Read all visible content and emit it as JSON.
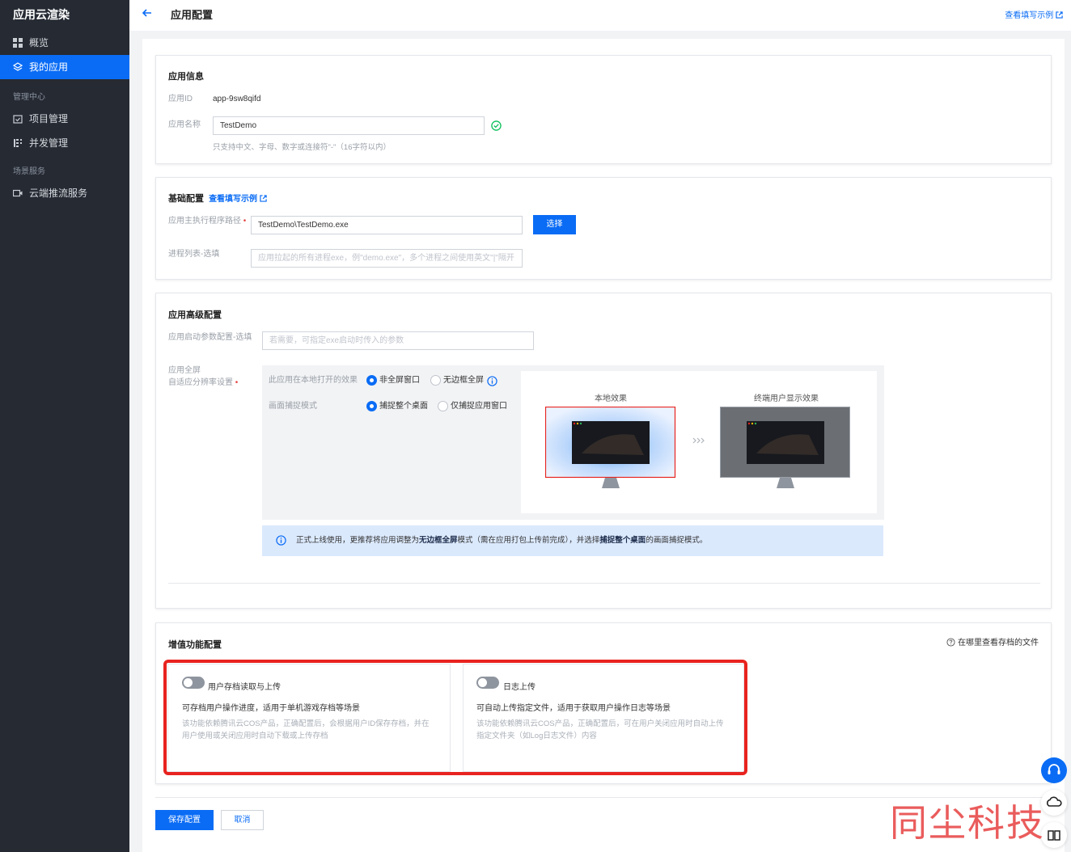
{
  "sidebar": {
    "brand": "应用云渲染",
    "items": [
      {
        "label": "概览"
      },
      {
        "label": "我的应用"
      }
    ],
    "section_mgmt": "管理中心",
    "mgmt_items": [
      {
        "label": "项目管理"
      },
      {
        "label": "并发管理"
      }
    ],
    "section_scene": "场景服务",
    "scene_items": [
      {
        "label": "云端推流服务"
      }
    ]
  },
  "header": {
    "title": "应用配置",
    "example_link": "查看填写示例"
  },
  "app_info": {
    "title": "应用信息",
    "id_label": "应用ID",
    "id_value": "app-9sw8qifd",
    "name_label": "应用名称",
    "name_value": "TestDemo",
    "name_hint": "只支持中文、字母、数字或连接符\"-\"（16字符以内）"
  },
  "basic": {
    "title": "基础配置",
    "example_link": "查看填写示例",
    "exe_label": "应用主执行程序路径",
    "exe_value": "TestDemo\\TestDemo.exe",
    "select_button": "选择",
    "process_label": "进程列表-选填",
    "process_placeholder": "应用拉起的所有进程exe，例\"demo.exe\"，多个进程之间使用英文\"|\"隔开"
  },
  "advanced": {
    "title": "应用高级配置",
    "params_label": "应用启动参数配置-选填",
    "params_placeholder": "若需要，可指定exe启动时传入的参数",
    "fullscreen_label_1": "应用全屏",
    "fullscreen_label_2": "自适应分辨率设置",
    "open_effect_label": "此应用在本地打开的效果",
    "open_opt_1": "非全屏窗口",
    "open_opt_2": "无边框全屏",
    "capture_label": "画面捕捉模式",
    "capture_opt_1": "捕捉整个桌面",
    "capture_opt_2": "仅捕捉应用窗口",
    "local_effect": "本地效果",
    "user_effect": "终端用户显示效果",
    "tip_prefix": "正式上线使用，更推荐将应用调整为",
    "tip_bold_1": "无边框全屏",
    "tip_mid": "模式（需在应用打包上传前完成），并选择",
    "tip_bold_2": "捕捉整个桌面",
    "tip_suffix": "的画面捕捉模式。"
  },
  "value_added": {
    "title": "增值功能配置",
    "help_link": "在哪里查看存档的文件",
    "features": [
      {
        "title": "用户存档读取与上传",
        "desc": "可存档用户操作进度，适用于单机游戏存档等场景",
        "sub": "该功能依赖腾讯云COS产品，正确配置后，会根据用户ID保存存档，并在用户使用或关闭应用时自动下载或上传存档"
      },
      {
        "title": "日志上传",
        "desc": "可自动上传指定文件，适用于获取用户操作日志等场景",
        "sub": "该功能依赖腾讯云COS产品，正确配置后，可在用户关闭应用时自动上传指定文件夹（如Log日志文件）内容"
      }
    ]
  },
  "footer": {
    "save_button": "保存配置",
    "cancel_button": "取消"
  },
  "watermark": "同尘科技",
  "colors": {
    "primary": "#0a6cf5",
    "sidebar_bg": "#252a33",
    "success": "#0abf5b",
    "highlight_red": "#e8231f"
  }
}
